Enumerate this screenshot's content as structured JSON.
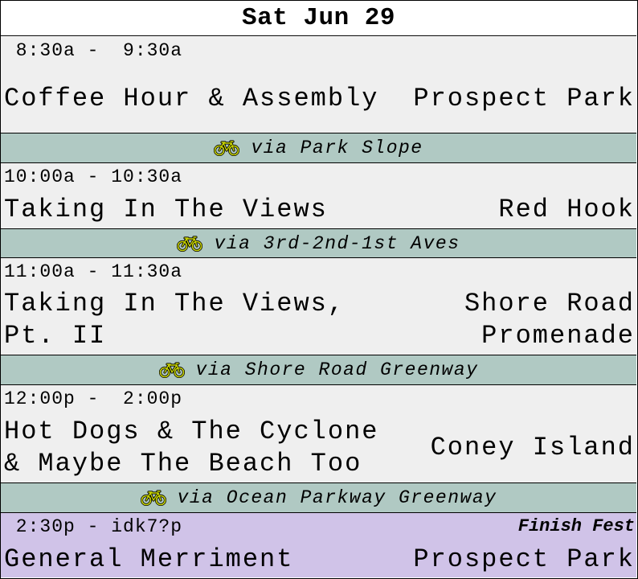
{
  "schedule": {
    "date": "Sat Jun 29",
    "events": [
      {
        "time": " 8:30a -  9:30a",
        "title": "Coffee Hour & Assembly",
        "place": "Prospect Park",
        "tag": ""
      },
      {
        "time": "10:00a - 10:30a",
        "title": "Taking In The Views",
        "place": "Red Hook",
        "tag": ""
      },
      {
        "time": "11:00a - 11:30a",
        "title": "Taking In The Views,\nPt. II",
        "place": "Shore Road\nPromenade",
        "tag": ""
      },
      {
        "time": "12:00p -  2:00p",
        "title": "Hot Dogs & The Cyclone\n& Maybe The Beach Too",
        "place": "Coney Island",
        "tag": ""
      },
      {
        "time": " 2:30p - idk7?p",
        "title": "General Merriment",
        "place": "Prospect Park",
        "tag": "Finish Fest"
      }
    ],
    "routes": [
      {
        "label": "via Park Slope",
        "icon": "bicycle-icon"
      },
      {
        "label": "via 3rd-2nd-1st Aves",
        "icon": "bicycle-icon"
      },
      {
        "label": "via Shore Road Greenway",
        "icon": "bicycle-icon"
      },
      {
        "label": "via Ocean Parkway Greenway",
        "icon": "bicycle-icon"
      }
    ],
    "colors": {
      "event_bg": "#efefef",
      "transit_bg": "#b0c9c3",
      "finish_bg": "#d0c3e8",
      "bike_color": "#c8d400"
    }
  }
}
